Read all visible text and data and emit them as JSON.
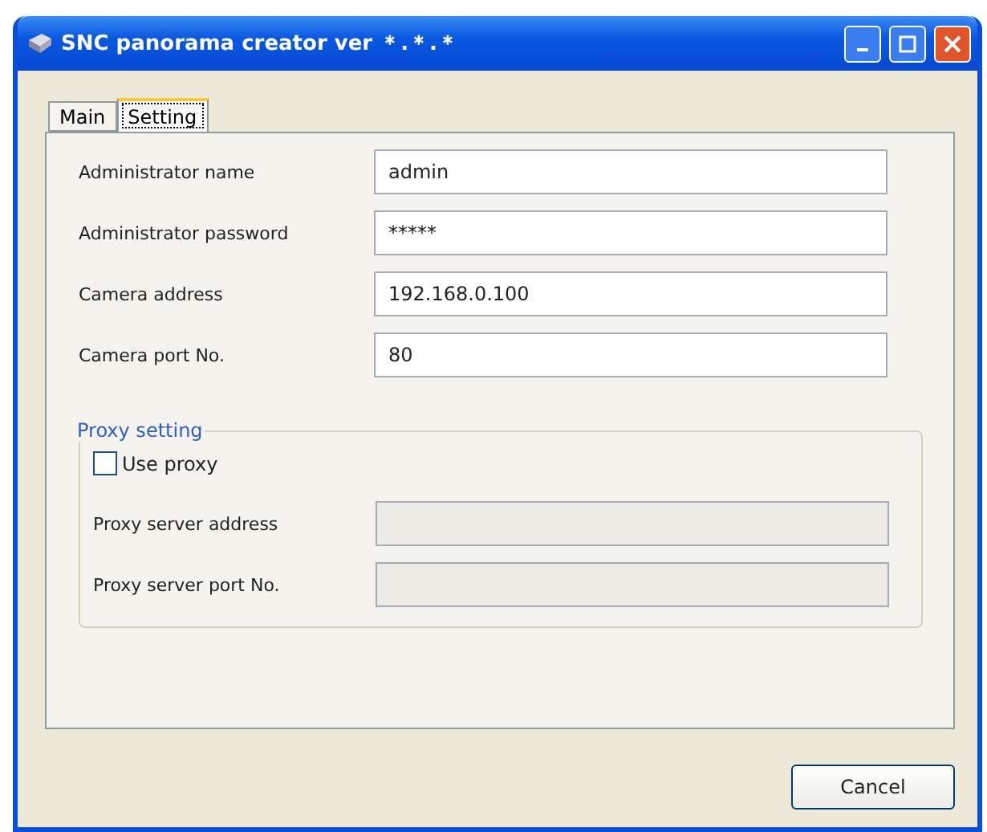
{
  "window": {
    "title": "SNC panorama creator ver ＊.＊.＊"
  },
  "tabs": [
    {
      "label": "Main",
      "selected": false
    },
    {
      "label": "Setting",
      "selected": true
    }
  ],
  "fields": [
    {
      "label": "Administrator name",
      "value": "admin"
    },
    {
      "label": "Administrator password",
      "value": "*****"
    },
    {
      "label": "Camera address",
      "value": "192.168.0.100"
    },
    {
      "label": "Camera port No.",
      "value": "80"
    }
  ],
  "proxy": {
    "title": "Proxy setting",
    "use_proxy": {
      "label": "Use proxy",
      "checked": false
    },
    "fields": [
      {
        "label": "Proxy server address",
        "disabled": true
      },
      {
        "label": "Proxy server port No.",
        "disabled": true
      }
    ]
  },
  "buttons": [
    {
      "label": "Cancel"
    }
  ]
}
